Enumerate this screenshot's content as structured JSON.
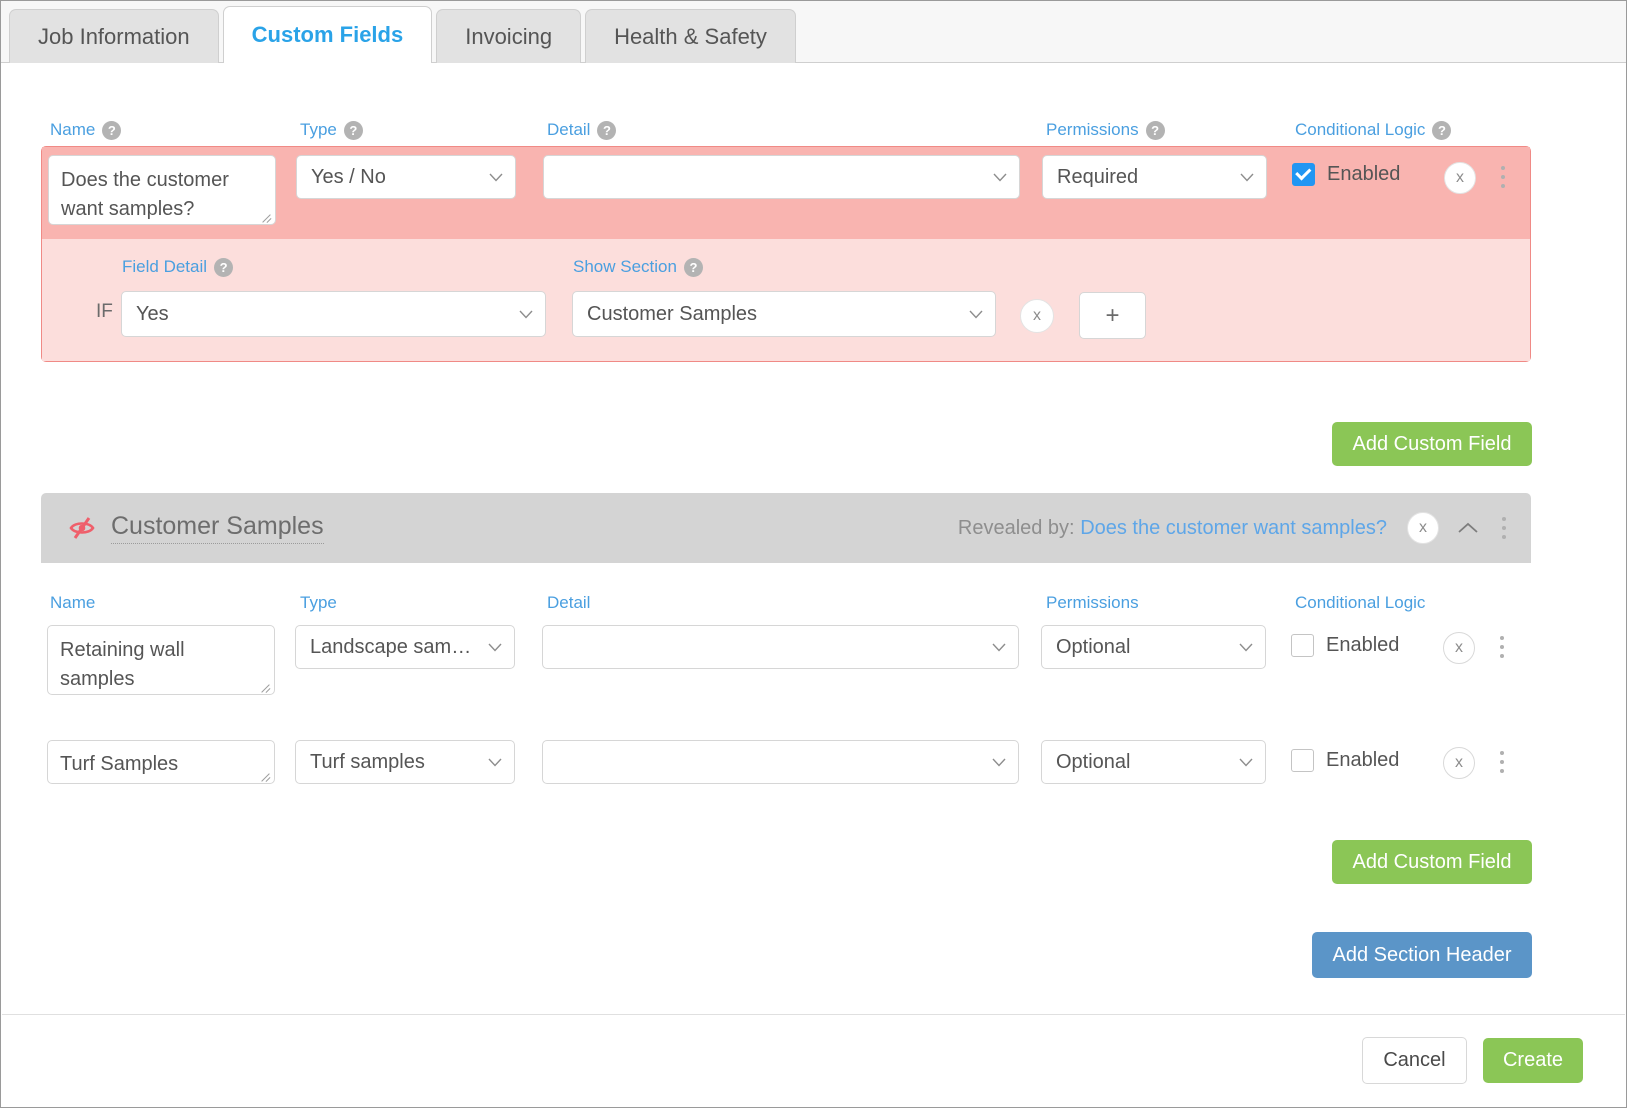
{
  "tabs": [
    {
      "label": "Job Information",
      "active": false
    },
    {
      "label": "Custom Fields",
      "active": true
    },
    {
      "label": "Invoicing",
      "active": false
    },
    {
      "label": "Health & Safety",
      "active": false
    }
  ],
  "column_headers": {
    "name": "Name",
    "type": "Type",
    "detail": "Detail",
    "permissions": "Permissions",
    "conditional_logic": "Conditional Logic",
    "help_glyph": "?"
  },
  "top_field": {
    "name_value": "Does the customer want samples?",
    "name_placeholder": "",
    "type_value": "Yes / No",
    "detail_value": "",
    "permissions_value": "Required",
    "conditional_enabled": true,
    "conditional_label": "Enabled",
    "remove_label": "x"
  },
  "conditional_logic_panel": {
    "field_detail_label": "Field Detail",
    "show_section_label": "Show Section",
    "if_label": "IF",
    "field_detail_value": "Yes",
    "show_section_value": "Customer Samples",
    "remove_label": "x",
    "add_label": "+"
  },
  "add_custom_field_top": "Add Custom Field",
  "section": {
    "title": "Customer Samples",
    "revealed_by_prefix": "Revealed by:",
    "revealed_by_field": "Does the customer want samples?",
    "remove_label": "x",
    "hidden_icon": "eye-slash-icon",
    "collapse_icon": "chevron-up-icon"
  },
  "section_column_headers": {
    "name": "Name",
    "type": "Type",
    "detail": "Detail",
    "permissions": "Permissions",
    "conditional_logic": "Conditional Logic"
  },
  "section_fields": [
    {
      "name_value": "Retaining wall samples",
      "type_value": "Landscape sam…",
      "detail_value": "",
      "permissions_value": "Optional",
      "conditional_enabled": false,
      "conditional_label": "Enabled",
      "remove_label": "x"
    },
    {
      "name_value": "Turf Samples",
      "type_value": "Turf samples",
      "detail_value": "",
      "permissions_value": "Optional",
      "conditional_enabled": false,
      "conditional_label": "Enabled",
      "remove_label": "x"
    }
  ],
  "add_custom_field_section": "Add Custom Field",
  "add_section_header": "Add Section Header",
  "footer": {
    "cancel": "Cancel",
    "create": "Create"
  },
  "colors": {
    "accent_blue": "#4a9fe0",
    "tab_active": "#2aa3e8",
    "highlight_row": "#f9b4b0",
    "highlight_sub": "#fcdedc",
    "highlight_border": "#f08a86",
    "green_button": "#8bc656",
    "blue_button": "#5b95c8",
    "section_header": "#d4d4d4",
    "checkbox_on": "#2196f3",
    "eye_slash": "#ef5f6b"
  }
}
